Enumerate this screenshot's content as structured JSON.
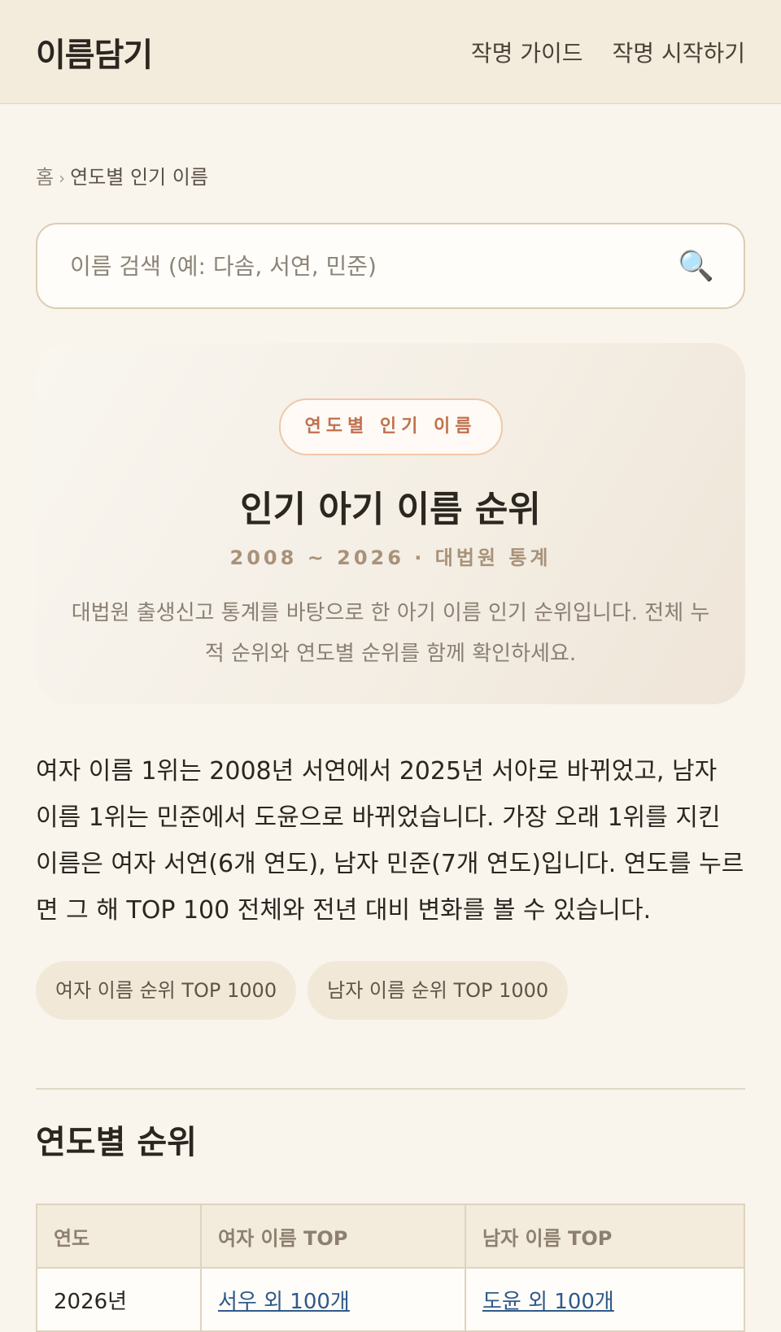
{
  "header": {
    "logo": "이름담기",
    "nav": [
      "작명 가이드",
      "작명 시작하기"
    ]
  },
  "breadcrumb": {
    "home": "홈",
    "separator": "›",
    "current": "연도별 인기 이름"
  },
  "search": {
    "placeholder": "이름 검색 (예: 다솜, 서연, 민준)",
    "value": "",
    "icon": "🔍"
  },
  "hero": {
    "badge": "연도별 인기 이름",
    "title": "인기 아기 이름 순위",
    "meta": "2008 ~ 2026 · 대법원 통계",
    "description": "대법원 출생신고 통계를 바탕으로 한 아기 이름 인기 순위입니다. 전체 누적 순위와 연도별 순위를 함께 확인하세요."
  },
  "summary": "여자 이름 1위는 2008년 서연에서 2025년 서아로 바뀌었고, 남자 이름 1위는 민준에서 도윤으로 바뀌었습니다. 가장 오래 1위를 지킨 이름은 여자 서연(6개 연도), 남자 민준(7개 연도)입니다. 연도를 누르면 그 해 TOP 100 전체와 전년 대비 변화를 볼 수 있습니다.",
  "chips": [
    "여자 이름 순위 TOP 1000",
    "남자 이름 순위 TOP 1000"
  ],
  "section": {
    "title": "연도별 순위"
  },
  "table": {
    "headers": [
      "연도",
      "여자 이름 TOP",
      "남자 이름 TOP"
    ],
    "rows": [
      {
        "year": "2026년",
        "girl": "서우 외 100개",
        "boy": "도윤 외 100개"
      }
    ]
  }
}
